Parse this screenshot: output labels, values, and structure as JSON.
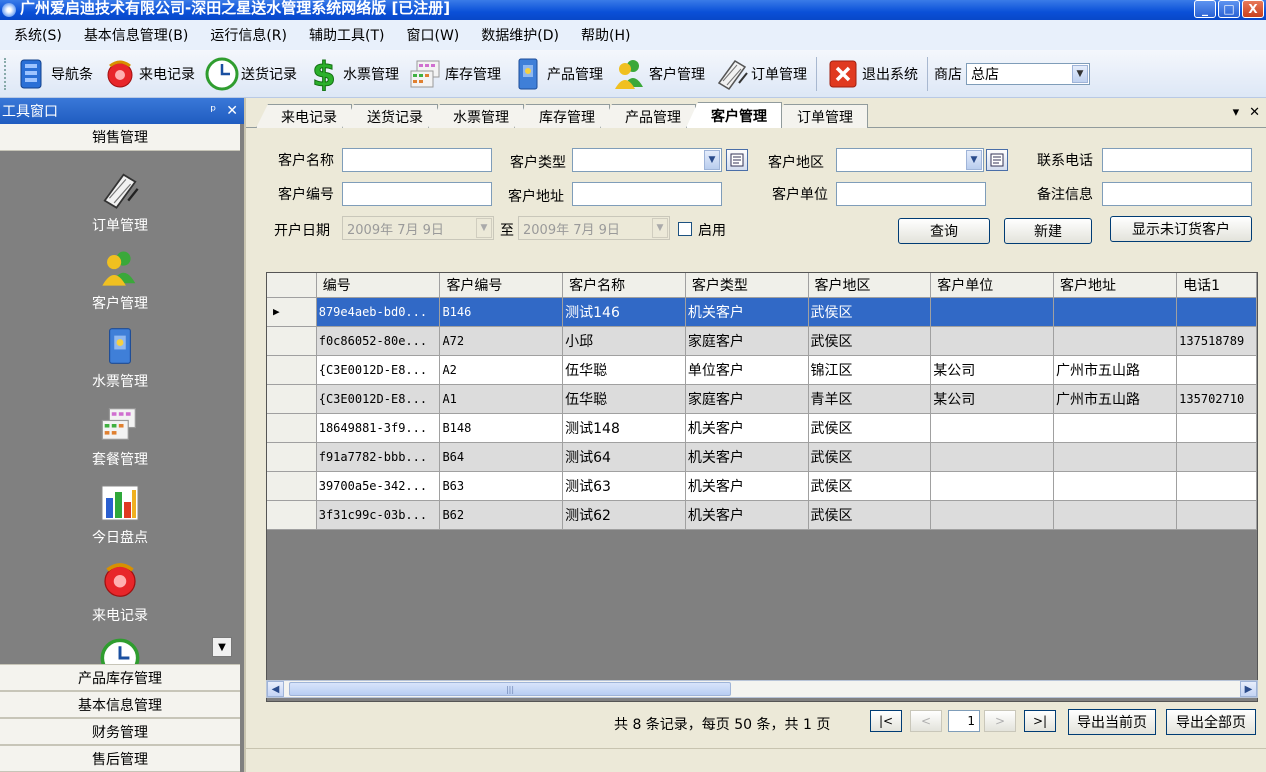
{
  "window": {
    "title": "广州爱启迪技术有限公司-深田之星送水管理系统网络版 [已注册]",
    "min_glyph": "_",
    "max_glyph": "□",
    "close_glyph": "X"
  },
  "menu": [
    "系统(S)",
    "基本信息管理(B)",
    "运行信息(R)",
    "辅助工具(T)",
    "窗口(W)",
    "数据维护(D)",
    "帮助(H)"
  ],
  "toolbar": {
    "buttons": [
      {
        "label": "导航条",
        "icon": "navigation-icon"
      },
      {
        "label": "来电记录",
        "icon": "phone-icon"
      },
      {
        "label": "送货记录",
        "icon": "clock-icon"
      },
      {
        "label": "水票管理",
        "icon": "dollar-icon"
      },
      {
        "label": "库存管理",
        "icon": "inventory-icon"
      },
      {
        "label": "产品管理",
        "icon": "product-icon"
      },
      {
        "label": "客户管理",
        "icon": "customers-icon"
      },
      {
        "label": "订单管理",
        "icon": "order-icon"
      },
      {
        "label": "退出系统",
        "icon": "exit-icon"
      }
    ],
    "shop_label": "商店",
    "shop_value": "总店"
  },
  "sidebar": {
    "title": "工具窗口",
    "pin_glyph": "ᵖ",
    "close_glyph": "✕",
    "top_section": "销售管理",
    "items": [
      {
        "label": "订单管理",
        "icon": "order-icon"
      },
      {
        "label": "客户管理",
        "icon": "customers-icon"
      },
      {
        "label": "水票管理",
        "icon": "ticket-icon"
      },
      {
        "label": "套餐管理",
        "icon": "package-icon"
      },
      {
        "label": "今日盘点",
        "icon": "chart-icon"
      },
      {
        "label": "来电记录",
        "icon": "phone-icon"
      }
    ],
    "bottom_sections": [
      "产品库存管理",
      "基本信息管理",
      "财务管理",
      "售后管理"
    ]
  },
  "tabs": {
    "items": [
      "来电记录",
      "送货记录",
      "水票管理",
      "库存管理",
      "产品管理",
      "客户管理",
      "订单管理"
    ],
    "active": 5,
    "menu_glyph": "▾",
    "close_glyph": "✕"
  },
  "form": {
    "name_label": "客户名称",
    "type_label": "客户类型",
    "region_label": "客户地区",
    "phone_label": "联系电话",
    "code_label": "客户编号",
    "address_label": "客户地址",
    "unit_label": "客户单位",
    "note_label": "备注信息",
    "date_label": "开户日期",
    "date_from": "2009年 7月 9日",
    "date_to_label": "至",
    "date_to": "2009年 7月 9日",
    "enable_label": "启用",
    "query_button": "查询",
    "new_button": "新建",
    "show_button": "显示未订货客户"
  },
  "grid": {
    "columns": [
      "编号",
      "客户编号",
      "客户名称",
      "客户类型",
      "客户地区",
      "客户单位",
      "客户地址",
      "电话1"
    ],
    "rows": [
      [
        "879e4aeb-bd0...",
        "B146",
        "测试146",
        "机关客户",
        "武侯区",
        "",
        "",
        ""
      ],
      [
        "f0c86052-80e...",
        "A72",
        "小邱",
        "家庭客户",
        "武侯区",
        "",
        "",
        "137518789"
      ],
      [
        "{C3E0012D-E8...",
        "A2",
        "伍华聪",
        "单位客户",
        "锦江区",
        "某公司",
        "广州市五山路",
        ""
      ],
      [
        "{C3E0012D-E8...",
        "A1",
        "伍华聪",
        "家庭客户",
        "青羊区",
        "某公司",
        "广州市五山路",
        "135702710"
      ],
      [
        "18649881-3f9...",
        "B148",
        "测试148",
        "机关客户",
        "武侯区",
        "",
        "",
        ""
      ],
      [
        "f91a7782-bbb...",
        "B64",
        "测试64",
        "机关客户",
        "武侯区",
        "",
        "",
        ""
      ],
      [
        "39700a5e-342...",
        "B63",
        "测试63",
        "机关客户",
        "武侯区",
        "",
        "",
        ""
      ],
      [
        "3f31c99c-03b...",
        "B62",
        "测试62",
        "机关客户",
        "武侯区",
        "",
        "",
        ""
      ]
    ],
    "selected_row": 0,
    "row_marker": "▶"
  },
  "pager": {
    "summary": "共 8 条记录，每页 50 条，共 1 页",
    "first": "|<",
    "prev": "<",
    "page": "1",
    "next": ">",
    "last": ">|",
    "export_current": "导出当前页",
    "export_all": "导出全部页"
  }
}
